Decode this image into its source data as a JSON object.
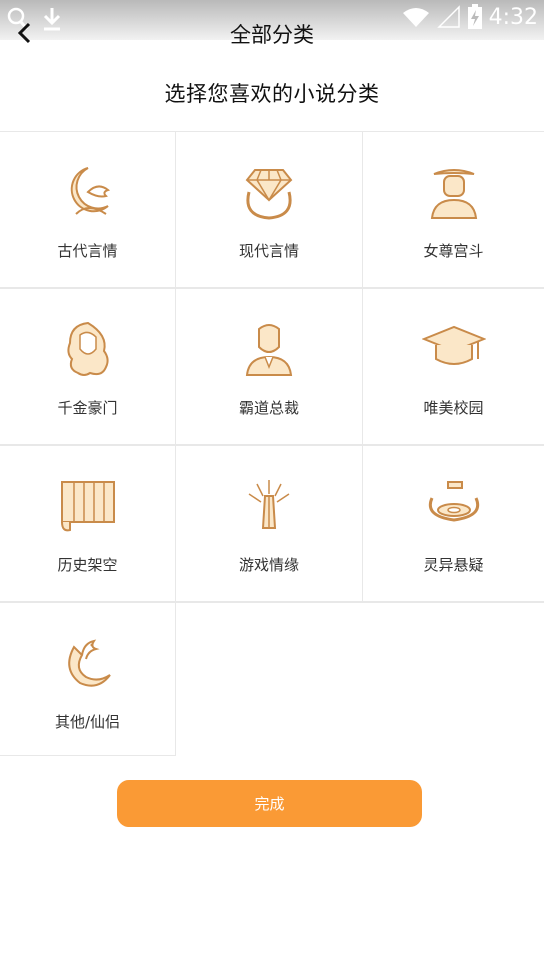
{
  "status_bar": {
    "time": "4:32"
  },
  "header": {
    "title": "全部分类"
  },
  "subtitle": "选择您喜欢的小说分类",
  "categories": [
    {
      "label": "古代言情",
      "icon": "crescent-moon-icon"
    },
    {
      "label": "现代言情",
      "icon": "diamond-ring-icon"
    },
    {
      "label": "女尊宫斗",
      "icon": "empress-bust-icon"
    },
    {
      "label": "千金豪门",
      "icon": "wavy-hair-woman-icon"
    },
    {
      "label": "霸道总裁",
      "icon": "ceo-man-icon"
    },
    {
      "label": "唯美校园",
      "icon": "graduation-cap-icon"
    },
    {
      "label": "历史架空",
      "icon": "bamboo-scroll-icon"
    },
    {
      "label": "游戏情缘",
      "icon": "praying-hands-icon"
    },
    {
      "label": "灵异悬疑",
      "icon": "mystic-bowl-icon"
    },
    {
      "label": "其他/仙侣",
      "icon": "phoenix-icon"
    }
  ],
  "done_button": {
    "label": "完成"
  },
  "colors": {
    "accent": "#fa9a35",
    "icon_stroke": "#c98b4a",
    "icon_fill": "#fbe7c8"
  }
}
